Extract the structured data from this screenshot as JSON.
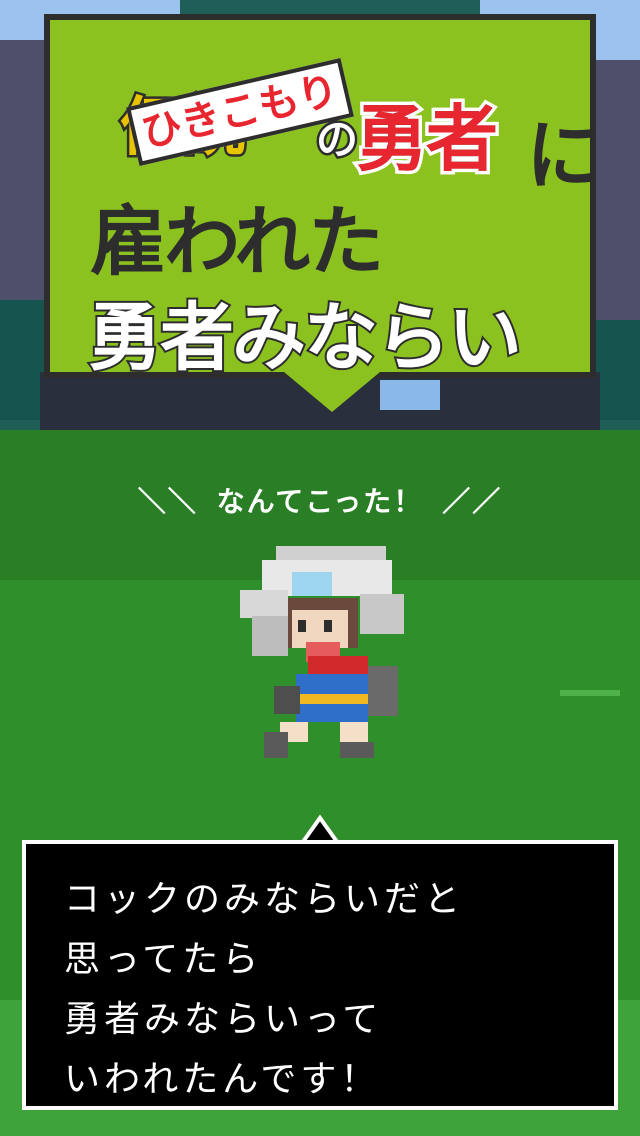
{
  "title": {
    "old_word": "伝説",
    "hikikomori_tag": "ひきこもり",
    "no": "の",
    "yusha": "勇者",
    "ni": "に",
    "line2": "雇われた",
    "line3": "勇者みならい"
  },
  "caption": {
    "left_deco": "＼＼",
    "text": "なんてこった！",
    "right_deco": "／／"
  },
  "dialog": {
    "lines": [
      "コックのみならいだと",
      "思ってたら",
      "勇者みならいって",
      "いわれたんです！"
    ]
  },
  "colors": {
    "banner": "#8cc21f",
    "grass": "#2f8f2a",
    "red": "#e8262f",
    "gold": "#e7c300"
  }
}
